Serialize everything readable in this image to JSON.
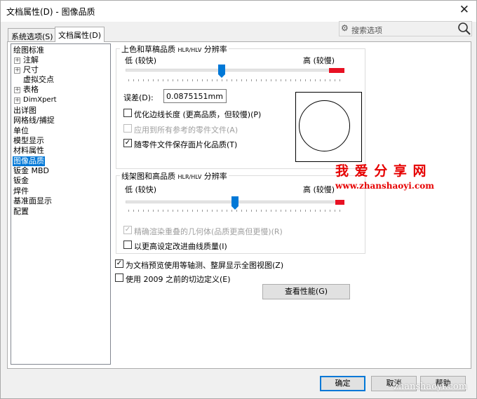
{
  "window": {
    "title": "文档属性(D) - 图像品质"
  },
  "tabs": [
    {
      "label": "系统选项(S)",
      "active": false
    },
    {
      "label": "文档属性(D)",
      "active": true
    }
  ],
  "search": {
    "placeholder": "搜索选项"
  },
  "tree": [
    {
      "label": "绘图标准",
      "expander": false
    },
    {
      "label": "注解",
      "expander": true
    },
    {
      "label": "尺寸",
      "expander": true
    },
    {
      "label": "虚拟交点",
      "expander": false
    },
    {
      "label": "表格",
      "expander": true
    },
    {
      "label": "DimXpert",
      "expander": true
    },
    {
      "label": "出详图",
      "expander": false
    },
    {
      "label": "网格线/捕捉",
      "expander": false
    },
    {
      "label": "单位",
      "expander": false
    },
    {
      "label": "模型显示",
      "expander": false
    },
    {
      "label": "材料属性",
      "expander": false
    },
    {
      "label": "图像品质",
      "expander": false,
      "selected": true
    },
    {
      "label": "钣金 MBD",
      "expander": false
    },
    {
      "label": "钣金",
      "expander": false
    },
    {
      "label": "焊件",
      "expander": false
    },
    {
      "label": "基准面显示",
      "expander": false
    },
    {
      "label": "配置",
      "expander": false
    }
  ],
  "shaded": {
    "title_main": "上色和草稿品质",
    "title_small": "HLR/HLV",
    "title_tail": "分辨率",
    "low_label": "低 (较快)",
    "high_label": "高 (较慢)",
    "level": 0.44,
    "deviation_label": "误差(D):",
    "deviation_value": "0.0875151mm",
    "options": [
      {
        "label": "优化边线长度 (更高品质，但较慢)(P)",
        "checked": false,
        "enabled": true
      },
      {
        "label": "应用到所有参考的零件文件(A)",
        "checked": false,
        "enabled": false
      },
      {
        "label": "随零件文件保存面片化品质(T)",
        "checked": true,
        "enabled": true
      }
    ]
  },
  "wireframe": {
    "title_main": "线架图和高品质",
    "title_small": "HLR/HLV",
    "title_tail": "分辨率",
    "low_label": "低 (较快)",
    "high_label": "高 (较慢)",
    "level": 0.5,
    "options": [
      {
        "label": "精确渲染重叠的几何体(品质更高但更慢)(R)",
        "checked": true,
        "enabled": false
      },
      {
        "label": "以更高设定改进曲线质量(I)",
        "checked": false,
        "enabled": true
      }
    ]
  },
  "bottom_options": [
    {
      "label": "为文档预览使用等轴测、整屏显示全图视图(Z)",
      "checked": true
    },
    {
      "label": "使用 2009 之前的切边定义(E)",
      "checked": false
    }
  ],
  "perf_button": "查看性能(G)",
  "buttons": {
    "ok": "确定",
    "cancel": "取消",
    "help": "帮助"
  },
  "watermark": {
    "text": "我 爱 分 享 网",
    "url": "www.zhanshaoyi.com",
    "corner": "zhanshaoyi.com"
  },
  "colors": {
    "accent": "#0078d7",
    "slider_high": "#e81123",
    "watermark": "#e60000"
  },
  "icons": {
    "search": "search-icon",
    "gear": "gear-icon",
    "close": "close-icon"
  }
}
